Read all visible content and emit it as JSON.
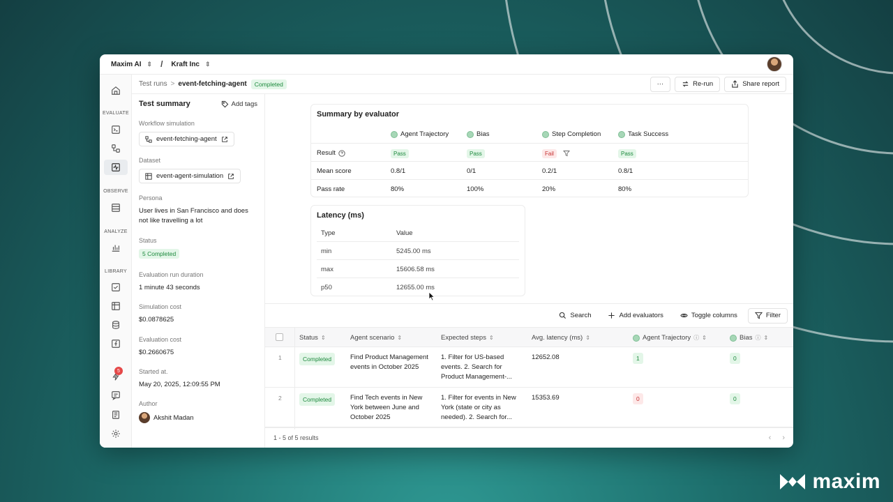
{
  "colors": {
    "accent_green": "#1e8a3e",
    "fail_red": "#c53030",
    "background_teal": "#1d6e6c"
  },
  "brand": {
    "name": "maxim"
  },
  "topbar": {
    "org": "Maxim AI",
    "workspace": "Kraft Inc",
    "separator": "/"
  },
  "rail": {
    "sections": {
      "evaluate": "EVALUATE",
      "observe": "OBSERVE",
      "analyze": "ANALYZE",
      "library": "LIBRARY"
    },
    "badge_count": "5",
    "icons": [
      "home-icon",
      "terminal-icon",
      "workflow-icon",
      "activity-icon",
      "logs-icon",
      "chart-icon",
      "checkbox-icon",
      "table-icon",
      "database-icon",
      "function-icon",
      "bolt-icon",
      "message-icon",
      "document-icon",
      "settings-icon"
    ]
  },
  "subheader": {
    "crumb_root": "Test runs",
    "crumb_sep": ">",
    "current": "event-fetching-agent",
    "status": "Completed",
    "more_label": "···",
    "rerun_label": "Re-run",
    "share_label": "Share report"
  },
  "summary": {
    "title": "Test summary",
    "add_tags": "Add tags",
    "workflow_label": "Workflow simulation",
    "workflow_value": "event-fetching-agent",
    "dataset_label": "Dataset",
    "dataset_value": "event-agent-simulation",
    "persona_label": "Persona",
    "persona_value": "User lives in San Francisco and does not like travelling a lot",
    "status_label": "Status",
    "status_value": "5 Completed",
    "duration_label": "Evaluation run duration",
    "duration_value": "1 minute 43 seconds",
    "sim_cost_label": "Simulation cost",
    "sim_cost_value": "$0.0878625",
    "eval_cost_label": "Evaluation cost",
    "eval_cost_value": "$0.2660675",
    "started_label": "Started at.",
    "started_value": "May 20, 2025, 12:09:55 PM",
    "author_label": "Author",
    "author_value": "Akshit Madan"
  },
  "by_evaluator": {
    "title": "Summary by evaluator",
    "evaluators": [
      "Agent Trajectory",
      "Bias",
      "Step Completion",
      "Task Success"
    ],
    "row_labels": {
      "result": "Result",
      "mean": "Mean score",
      "pass_rate": "Pass rate"
    },
    "result": [
      "Pass",
      "Pass",
      "Fail",
      "Pass"
    ],
    "mean": [
      "0.8/1",
      "0/1",
      "0.2/1",
      "0.8/1"
    ],
    "pass_rate": [
      "80%",
      "100%",
      "20%",
      "80%"
    ]
  },
  "latency": {
    "title": "Latency (ms)",
    "col_type": "Type",
    "col_value": "Value",
    "rows": [
      {
        "type": "min",
        "value": "5245.00 ms"
      },
      {
        "type": "max",
        "value": "15606.58 ms"
      },
      {
        "type": "p50",
        "value": "12655.00 ms"
      }
    ]
  },
  "toolbar": {
    "search": "Search",
    "add_evaluators": "Add evaluators",
    "toggle_columns": "Toggle columns",
    "filter": "Filter"
  },
  "table": {
    "headers": {
      "status": "Status",
      "scenario": "Agent scenario",
      "steps": "Expected steps",
      "latency": "Avg. latency (ms)",
      "trajectory": "Agent Trajectory",
      "bias": "Bias"
    },
    "rows": [
      {
        "num": "1",
        "status": "Completed",
        "scenario": "Find Product Management events in October 2025",
        "steps": "1. Filter for US-based events. 2. Search for Product Management-...",
        "latency": "12652.08",
        "trajectory": "1",
        "bias": "0"
      },
      {
        "num": "2",
        "status": "Completed",
        "scenario": "Find Tech events in New York between June and October 2025",
        "steps": "1. Filter for events in New York (state or city as needed). 2. Search for...",
        "latency": "15353.69",
        "trajectory": "0",
        "bias": "0"
      }
    ]
  },
  "footer": {
    "results": "1 - 5 of 5 results",
    "prev": "‹",
    "next": "›"
  }
}
